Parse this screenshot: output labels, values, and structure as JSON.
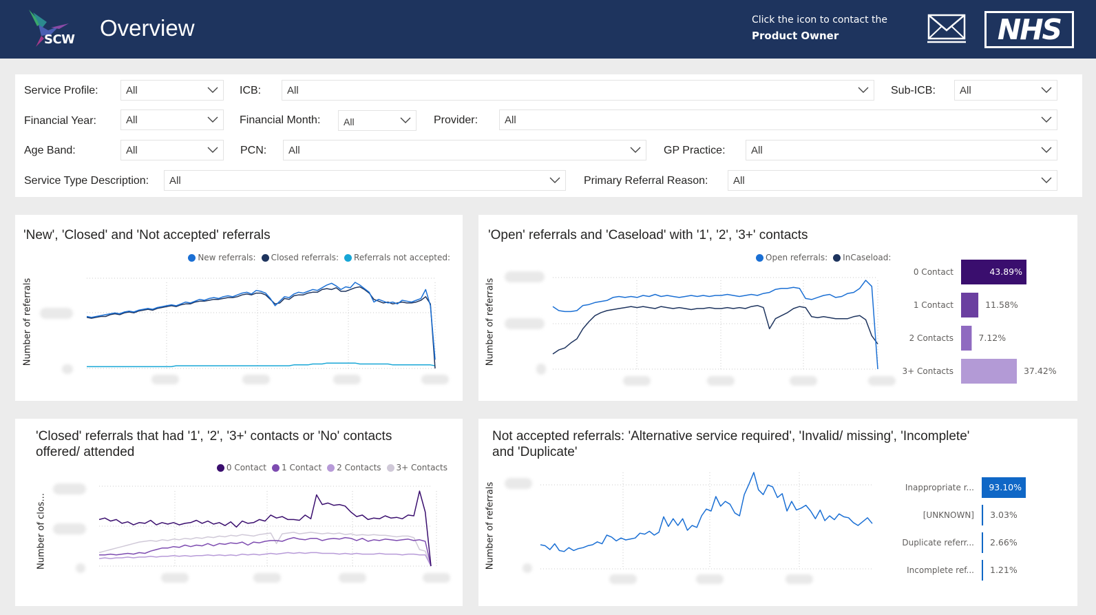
{
  "header": {
    "logo_text": "SCW",
    "title": "Overview",
    "contact_line1": "Click the icon to contact the",
    "contact_line2": "Product Owner",
    "nhs_logo_text": "NHS",
    "background": "#1e345e"
  },
  "filters": {
    "service_profile": {
      "label": "Service Profile:",
      "value": "All"
    },
    "icb": {
      "label": "ICB:",
      "value": "All"
    },
    "sub_icb": {
      "label": "Sub-ICB:",
      "value": "All"
    },
    "financial_year": {
      "label": "Financial Year:",
      "value": "All"
    },
    "financial_month": {
      "label": "Financial Month:",
      "value": "All"
    },
    "provider": {
      "label": "Provider:",
      "value": "All"
    },
    "age_band": {
      "label": "Age Band:",
      "value": "All"
    },
    "pcn": {
      "label": "PCN:",
      "value": "All"
    },
    "gp_practice": {
      "label": "GP Practice:",
      "value": "All"
    },
    "service_type_description": {
      "label": "Service Type Description:",
      "value": "All"
    },
    "primary_referral_reason": {
      "label": "Primary Referral Reason:",
      "value": "All"
    }
  },
  "cards": {
    "referrals": {
      "title": "'New', 'Closed' and 'Not accepted' referrals",
      "ylabel": "Number of referrals",
      "legend": [
        {
          "label": "New referrals:",
          "color": "#1a6fd4"
        },
        {
          "label": "Closed referrals:",
          "color": "#1e345e"
        },
        {
          "label": "Referrals not accepted:",
          "color": "#17a6d6"
        }
      ]
    },
    "open": {
      "title": "'Open' referrals and 'Caseload' with '1', '2', '3+' contacts",
      "ylabel": "Number of referrals",
      "legend": [
        {
          "label": "Open referrals:",
          "color": "#1a6fd4"
        },
        {
          "label": "InCaseload:",
          "color": "#1e345e"
        }
      ]
    },
    "closed_contacts": {
      "title_line1": "'Closed' referrals that had '1', '2', '3+' contacts or 'No' contacts",
      "title_line2": "offered/ attended",
      "ylabel": "Number of clos...",
      "legend": [
        {
          "label": "0 Contact",
          "color": "#3a0e6e"
        },
        {
          "label": "1 Contact",
          "color": "#7d4bb0"
        },
        {
          "label": "2 Contacts",
          "color": "#b79ad8"
        },
        {
          "label": "3+ Contacts",
          "color": "#d0c9d8"
        }
      ]
    },
    "not_accepted": {
      "title_line1": "Not accepted referrals: 'Alternative service required', 'Invalid/ missing', 'Incomplete'",
      "title_line2": "and 'Duplicate'",
      "ylabel": "Number of referrals"
    }
  },
  "chart_data": [
    {
      "type": "line",
      "title": "'New', 'Closed' and 'Not accepted' referrals",
      "ylabel": "Number of referrals",
      "series": [
        {
          "name": "New referrals:",
          "color": "#1a6fd4",
          "values": [
            58,
            57,
            58,
            59,
            60,
            61,
            62,
            61,
            63,
            64,
            63,
            65,
            66,
            67,
            66,
            68,
            69,
            70,
            71,
            70,
            72,
            74,
            73,
            75,
            77,
            76,
            78,
            79,
            78,
            80,
            81,
            80,
            82,
            84,
            85,
            83,
            87,
            86,
            84,
            78,
            70,
            75,
            80,
            79,
            83,
            85,
            84,
            86,
            88,
            87,
            90,
            93,
            95,
            92,
            88,
            91,
            90,
            96,
            93,
            89,
            85,
            74,
            77,
            75,
            73,
            74,
            72,
            76,
            75,
            74,
            76,
            78,
            88,
            70,
            10
          ]
        },
        {
          "name": "Closed referrals:",
          "color": "#1e345e",
          "values": [
            57,
            56,
            57,
            58,
            58,
            60,
            61,
            60,
            62,
            63,
            62,
            64,
            65,
            66,
            65,
            67,
            68,
            69,
            70,
            69,
            71,
            72,
            72,
            74,
            75,
            75,
            76,
            77,
            77,
            78,
            79,
            79,
            80,
            82,
            83,
            82,
            84,
            84,
            82,
            77,
            72,
            73,
            78,
            77,
            81,
            82,
            82,
            84,
            85,
            85,
            88,
            89,
            88,
            90,
            86,
            86,
            88,
            90,
            91,
            88,
            84,
            77,
            75,
            73,
            74,
            72,
            73,
            74,
            73,
            73,
            74,
            76,
            80,
            72,
            0
          ]
        },
        {
          "name": "Referrals not accepted:",
          "color": "#17a6d6",
          "values": [
            2,
            2,
            2,
            2,
            2,
            2,
            2,
            2,
            2,
            2,
            2,
            2,
            2,
            2,
            2,
            2,
            2,
            2,
            2,
            3,
            3,
            3,
            3,
            3,
            3,
            3,
            3,
            3,
            3,
            3,
            3,
            3,
            3,
            3,
            3,
            3,
            3,
            3,
            3,
            3,
            3,
            3,
            3,
            3,
            4,
            4,
            4,
            4,
            5,
            5,
            5,
            6,
            6,
            6,
            6,
            6,
            6,
            6,
            5,
            5,
            5,
            5,
            5,
            5,
            5,
            4,
            4,
            4,
            4,
            4,
            4,
            4,
            4,
            4,
            3
          ]
        }
      ]
    },
    {
      "type": "line",
      "title": "'Open' referrals and 'Caseload' with '1', '2', '3+' contacts",
      "ylabel": "Number of referrals",
      "series": [
        {
          "name": "Open referrals:",
          "color": "#1a6fd4",
          "values": [
            62,
            58,
            57,
            57,
            58,
            63,
            64,
            66,
            67,
            68,
            71,
            72,
            71,
            72,
            71,
            73,
            72,
            74,
            72,
            73,
            72,
            71,
            72,
            73,
            72,
            73,
            72,
            73,
            73,
            74,
            73,
            72,
            73,
            74,
            73,
            75,
            76,
            79,
            80,
            80,
            81,
            80,
            70,
            69,
            71,
            73,
            74,
            71,
            72,
            75,
            76,
            80,
            88,
            82,
            0
          ]
        },
        {
          "name": "InCaseload:",
          "color": "#1e345e",
          "values": [
            15,
            19,
            21,
            26,
            30,
            40,
            47,
            53,
            56,
            58,
            59,
            60,
            61,
            62,
            61,
            62,
            61,
            60,
            62,
            61,
            60,
            61,
            60,
            59,
            60,
            60,
            61,
            60,
            60,
            61,
            60,
            61,
            60,
            62,
            63,
            61,
            40,
            50,
            53,
            56,
            60,
            62,
            61,
            52,
            51,
            52,
            51,
            50,
            50,
            50,
            52,
            53,
            49,
            33,
            25
          ]
        }
      ]
    },
    {
      "type": "bar",
      "orientation": "horizontal",
      "categories": [
        "0 Contact",
        "1 Contact",
        "2 Contacts",
        "3+ Contacts"
      ],
      "values": [
        43.89,
        11.58,
        7.12,
        37.42
      ],
      "data_labels": [
        "43.89%",
        "11.58%",
        "7.12%",
        "37.42%"
      ],
      "colors": [
        "#3a0e6e",
        "#6b3fa0",
        "#8f6ac0",
        "#b39ad6"
      ]
    },
    {
      "type": "line",
      "title": "'Closed' referrals that had '1', '2', '3+' contacts or 'No' contacts offered/ attended",
      "ylabel": "Number of clos...",
      "series": [
        {
          "name": "0 Contact",
          "color": "#3a0e6e",
          "values": [
            62,
            64,
            60,
            62,
            57,
            59,
            55,
            58,
            57,
            61,
            55,
            58,
            56,
            58,
            55,
            57,
            58,
            61,
            57,
            60,
            56,
            58,
            54,
            59,
            52,
            60,
            57,
            58,
            62,
            60,
            68,
            64,
            66,
            62,
            62,
            61,
            68,
            63,
            95,
            82,
            84,
            81,
            82,
            80,
            72,
            66,
            68,
            62,
            64,
            63,
            67,
            64,
            65,
            63,
            68,
            67,
            100,
            72,
            0
          ]
        },
        {
          "name": "1 Contact",
          "color": "#7d4bb0",
          "values": [
            15,
            15,
            16,
            15,
            16,
            17,
            16,
            18,
            17,
            20,
            22,
            24,
            24,
            26,
            25,
            28,
            26,
            28,
            27,
            30,
            27,
            30,
            29,
            31,
            30,
            32,
            28,
            32,
            31,
            33,
            34,
            34,
            33,
            36,
            38,
            36,
            35,
            37,
            37,
            34,
            36,
            37,
            36,
            38,
            37,
            34,
            37,
            33,
            35,
            34,
            36,
            35,
            34,
            35,
            36,
            34,
            35,
            33,
            0
          ]
        },
        {
          "name": "2 Contacts",
          "color": "#b79ad8",
          "values": [
            10,
            11,
            10,
            11,
            11,
            12,
            11,
            12,
            12,
            13,
            12,
            13,
            13,
            14,
            13,
            14,
            13,
            14,
            14,
            15,
            14,
            15,
            14,
            15,
            14,
            16,
            15,
            16,
            15,
            16,
            17,
            16,
            17,
            18,
            17,
            18,
            17,
            18,
            18,
            17,
            17,
            17,
            16,
            17,
            16,
            17,
            16,
            16,
            16,
            17,
            16,
            16,
            16,
            15,
            16,
            16,
            15,
            15,
            0
          ]
        },
        {
          "name": "3+ Contacts",
          "color": "#d0c9d8",
          "values": [
            18,
            20,
            22,
            24,
            26,
            28,
            30,
            32,
            33,
            34,
            33,
            35,
            34,
            36,
            35,
            37,
            36,
            38,
            37,
            39,
            38,
            40,
            39,
            41,
            40,
            42,
            41,
            40,
            42,
            43,
            44,
            30,
            43,
            44,
            45,
            43,
            44,
            45,
            44,
            43,
            44,
            43,
            44,
            42,
            43,
            41,
            42,
            41,
            42,
            41,
            41,
            40,
            39,
            40,
            40,
            38,
            22,
            20,
            0
          ]
        }
      ]
    },
    {
      "type": "line",
      "title": "Not accepted referrals: 'Alternative service required', 'Invalid/ missing', 'Incomplete' and 'Duplicate'",
      "ylabel": "Number of referrals",
      "series": [
        {
          "name": "",
          "color": "#1a6fd4",
          "values": [
            25,
            24,
            20,
            26,
            19,
            18,
            22,
            19,
            21,
            22,
            24,
            25,
            28,
            26,
            35,
            33,
            29,
            32,
            30,
            31,
            32,
            37,
            36,
            39,
            35,
            38,
            54,
            44,
            52,
            45,
            52,
            40,
            45,
            43,
            55,
            62,
            60,
            75,
            65,
            70,
            67,
            58,
            55,
            77,
            88,
            100,
            82,
            77,
            87,
            85,
            74,
            78,
            60,
            70,
            61,
            63,
            66,
            60,
            52,
            61,
            50,
            55,
            51,
            57,
            54,
            53,
            48,
            45,
            49,
            53,
            47
          ]
        }
      ]
    },
    {
      "type": "bar",
      "orientation": "horizontal",
      "categories": [
        "Inappropriate r...",
        "[UNKNOWN]",
        "Duplicate referr...",
        "Incomplete ref..."
      ],
      "values": [
        93.1,
        3.03,
        2.66,
        1.21
      ],
      "data_labels": [
        "93.10%",
        "3.03%",
        "2.66%",
        "1.21%"
      ],
      "colors": [
        "#0f67c6",
        "#0f67c6",
        "#0f67c6",
        "#0f67c6"
      ]
    }
  ]
}
